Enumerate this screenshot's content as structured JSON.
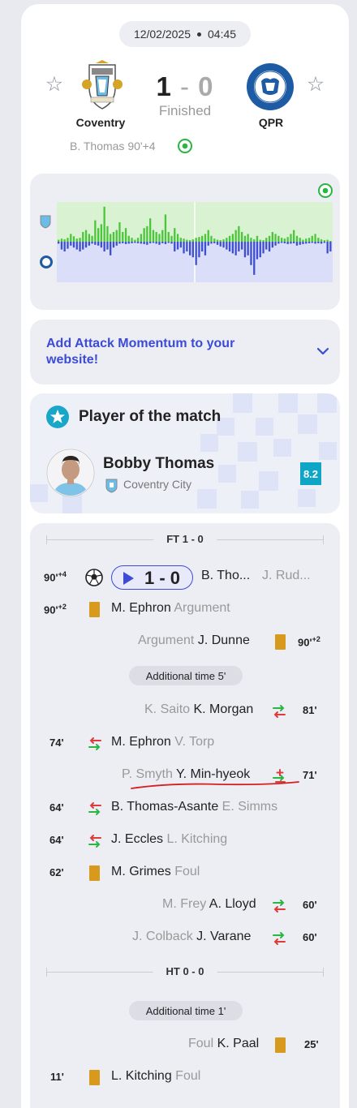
{
  "header": {
    "date": "12/02/2025",
    "time": "04:45",
    "home_team": "Coventry",
    "away_team": "QPR",
    "home_score": "1",
    "score_dash": "-",
    "away_score": "0",
    "status": "Finished",
    "scorer": "B. Thomas 90'+4"
  },
  "momentum": {
    "home_values": [
      0.05,
      0.08,
      0.06,
      0.1,
      0.2,
      0.14,
      0.08,
      0.1,
      0.25,
      0.3,
      0.2,
      0.15,
      0.55,
      0.35,
      0.45,
      0.9,
      0.4,
      0.2,
      0.25,
      0.3,
      0.5,
      0.25,
      0.35,
      0.15,
      0.1,
      0.05,
      0.1,
      0.2,
      0.35,
      0.4,
      0.6,
      0.3,
      0.25,
      0.2,
      0.3,
      0.7,
      0.25,
      0.15,
      0.35,
      0.2,
      0.1,
      0.08,
      0.05,
      0.04,
      0.06,
      0.1,
      0.12,
      0.15,
      0.2,
      0.3,
      0.15,
      0.08,
      0.05,
      0.04,
      0.06,
      0.1,
      0.15,
      0.2,
      0.3,
      0.4,
      0.25,
      0.15,
      0.2,
      0.1,
      0.06,
      0.15,
      0.05,
      0.04,
      0.1,
      0.15,
      0.25,
      0.2,
      0.15,
      0.1,
      0.08,
      0.12,
      0.2,
      0.3,
      0.15,
      0.1,
      0.05,
      0.08,
      0.1,
      0.15,
      0.2,
      0.1,
      0.06,
      0.04,
      0.05,
      0.02
    ],
    "away_values": [
      0.05,
      0.2,
      0.25,
      0.18,
      0.1,
      0.15,
      0.2,
      0.25,
      0.2,
      0.15,
      0.1,
      0.05,
      0.08,
      0.1,
      0.15,
      0.25,
      0.2,
      0.35,
      0.15,
      0.1,
      0.05,
      0.04,
      0.06,
      0.05,
      0.04,
      0.03,
      0.04,
      0.05,
      0.06,
      0.08,
      0.04,
      0.03,
      0.05,
      0.08,
      0.04,
      0.06,
      0.03,
      0.05,
      0.25,
      0.2,
      0.15,
      0.3,
      0.25,
      0.35,
      0.4,
      0.6,
      0.4,
      0.25,
      0.35,
      0.1,
      0.05,
      0.04,
      0.08,
      0.12,
      0.15,
      0.2,
      0.25,
      0.3,
      0.35,
      0.25,
      0.2,
      0.4,
      0.35,
      0.6,
      0.85,
      0.45,
      0.4,
      0.3,
      0.2,
      0.25,
      0.15,
      0.1,
      0.05,
      0.03,
      0.04,
      0.06,
      0.05,
      0.04,
      0.1,
      0.08,
      0.06,
      0.05,
      0.04,
      0.03,
      0.05,
      0.04,
      0.05,
      0.03,
      0.3,
      0.25
    ]
  },
  "attack_momentum": {
    "label": "Add Attack Momentum to your website!"
  },
  "potm": {
    "title": "Player of the match",
    "player": "Bobby Thomas",
    "team": "Coventry City",
    "rating": "8.2"
  },
  "incidents": {
    "ft_label": "FT 1 - 0",
    "ht_label": "HT 0 - 0",
    "addtime_2": "Additional time 5'",
    "addtime_1": "Additional time 1'",
    "goal": {
      "minute": "90'",
      "extra": "+4",
      "score": "1 - 0",
      "scorer": "B. Tho...",
      "assist": "J. Rud..."
    },
    "card_home_1": {
      "minute": "90'",
      "extra": "+2",
      "player": "M. Ephron",
      "reason": "Argument"
    },
    "card_away_1": {
      "minute": "90'",
      "extra": "+2",
      "player": "J. Dunne",
      "reason": "Argument"
    },
    "sub_away_1": {
      "minute": "81'",
      "in": "K. Morgan",
      "out": "K. Saito"
    },
    "sub_home_1": {
      "minute": "74'",
      "in": "M. Ephron",
      "out": "V. Torp"
    },
    "sub_away_2": {
      "minute": "71'",
      "in": "Y. Min-hyeok",
      "out": "P. Smyth"
    },
    "sub_home_2": {
      "minute": "64'",
      "in": "B. Thomas-Asante",
      "out": "E. Simms"
    },
    "sub_home_3": {
      "minute": "64'",
      "in": "J. Eccles",
      "out": "L. Kitching"
    },
    "card_home_2": {
      "minute": "62'",
      "player": "M. Grimes",
      "reason": "Foul"
    },
    "sub_away_3": {
      "minute": "60'",
      "in": "A. Lloyd",
      "out": "M. Frey"
    },
    "sub_away_4": {
      "minute": "60'",
      "in": "J. Varane",
      "out": "J. Colback"
    },
    "card_away_2": {
      "minute": "25'",
      "player": "K. Paal",
      "reason": "Foul"
    },
    "card_home_3": {
      "minute": "11'",
      "player": "L. Kitching",
      "reason": "Foul"
    }
  },
  "colors": {
    "accent": "#3c4bd6",
    "home_momentum": "#4cc53c",
    "away_momentum": "#3d4fd0",
    "yellow_card": "#d89a1c",
    "rating": "#0fa5c7",
    "annotation": "#d42020"
  }
}
